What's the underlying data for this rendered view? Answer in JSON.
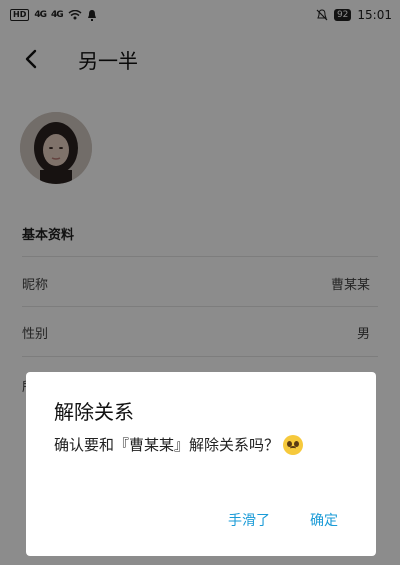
{
  "status_bar": {
    "hd_badge": "HD",
    "sig1": "4G",
    "sig2": "4G",
    "battery": "92",
    "time": "15:01"
  },
  "header": {
    "title": "另一半"
  },
  "profile": {
    "section_title": "基本资料",
    "rows": [
      {
        "label": "昵称",
        "value": "曹某某"
      },
      {
        "label": "性别",
        "value": "男"
      }
    ],
    "partial_row_label": "所"
  },
  "dialog": {
    "title": "解除关系",
    "message": "确认要和『曹某某』解除关系吗？",
    "cancel_label": "手滑了",
    "confirm_label": "确定"
  },
  "colors": {
    "accent": "#1a9bd7",
    "overlay": "rgba(0,0,0,0.45)"
  }
}
